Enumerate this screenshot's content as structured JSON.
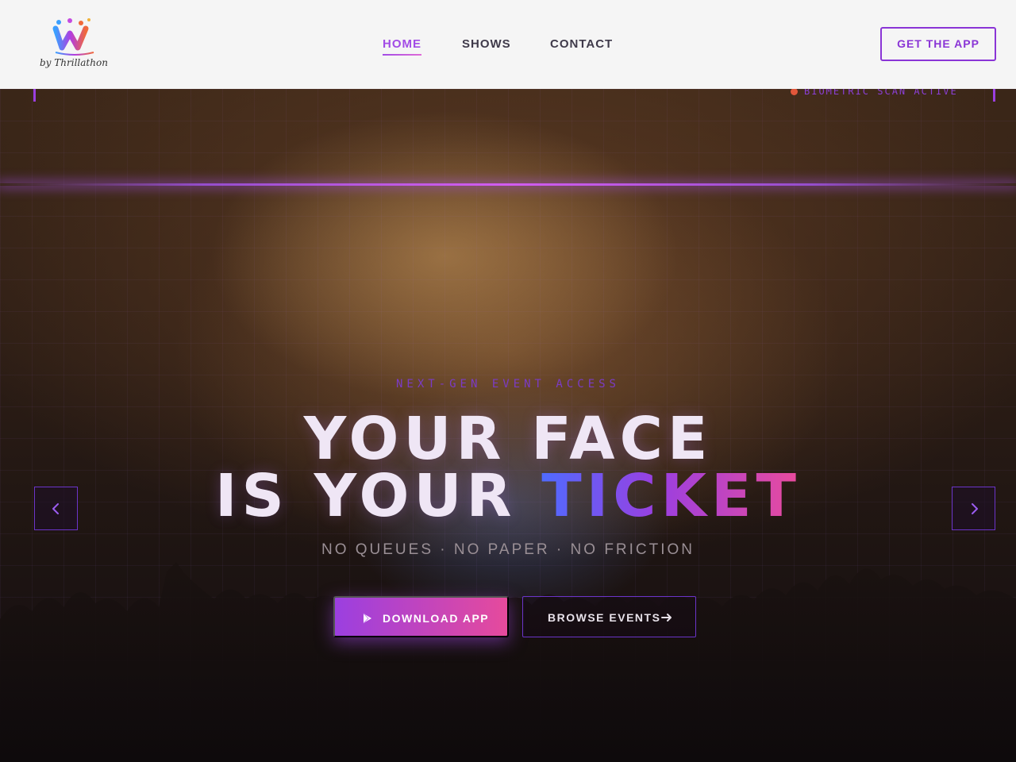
{
  "brand": {
    "logo_letter": "W",
    "tagline": "by Thrillathon",
    "colors": {
      "accent": "#9b3fe0",
      "pink": "#e64a9c",
      "blue": "#4f6bff",
      "nav_bg": "#f5f5f5"
    }
  },
  "nav": {
    "items": [
      {
        "label": "HOME",
        "active": true
      },
      {
        "label": "SHOWS",
        "active": false
      },
      {
        "label": "CONTACT",
        "active": false
      }
    ],
    "cta_label": "GET THE APP"
  },
  "hero": {
    "status_text": "BIOMETRIC SCAN ACTIVE",
    "eyebrow": "NEXT-GEN EVENT ACCESS",
    "headline_line1": "YOUR FACE",
    "headline_line2_prefix": "IS YOUR ",
    "headline_line2_accent": "TICKET",
    "tagline": "NO QUEUES · NO PAPER · NO FRICTION",
    "primary_button": {
      "label": "DOWNLOAD APP",
      "icon": "play-store-icon"
    },
    "secondary_button": {
      "label": "BROWSE EVENTS",
      "icon": "arrow-right-icon"
    },
    "prev_icon": "chevron-left-icon",
    "next_icon": "chevron-right-icon"
  }
}
